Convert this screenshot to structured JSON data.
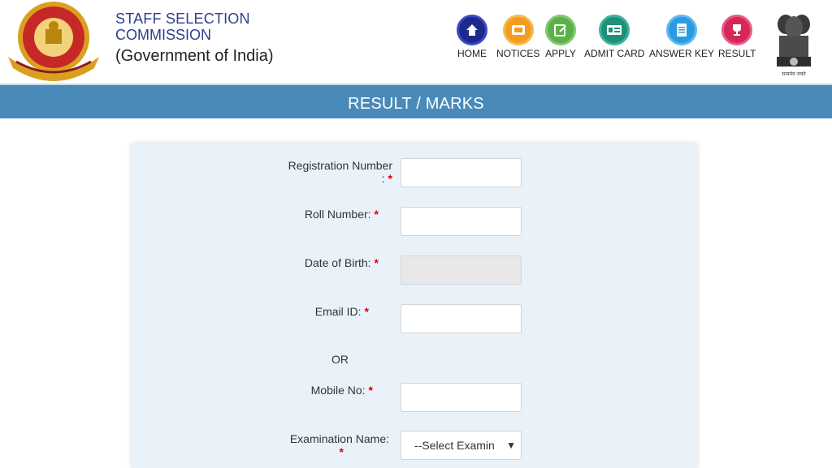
{
  "header": {
    "title_line1": "STAFF SELECTION",
    "title_line2": "COMMISSION",
    "title_line3": "(Government of India)",
    "emblem_caption": "सत्यमेव जयते"
  },
  "nav": [
    {
      "label": "HOME",
      "icon": "home-icon",
      "color": "#1d2a8c"
    },
    {
      "label": "NOTICES",
      "icon": "notices-icon",
      "color": "#f39c1f"
    },
    {
      "label": "APPLY",
      "icon": "apply-icon",
      "color": "#5bb04a"
    },
    {
      "label": "ADMIT CARD",
      "icon": "admit-card-icon",
      "color": "#1f8f7a"
    },
    {
      "label": "ANSWER KEY",
      "icon": "answer-key-icon",
      "color": "#2a9be0"
    },
    {
      "label": "RESULT",
      "icon": "result-icon",
      "color": "#d62858"
    }
  ],
  "banner": {
    "title": "RESULT / MARKS"
  },
  "form": {
    "registration_label": "Registration Number",
    "registration_suffix": ":",
    "roll_label": "Roll Number:",
    "dob_label": "Date of Birth:",
    "email_label": "Email ID:",
    "or_text": "OR",
    "mobile_label": "Mobile No:",
    "exam_label": "Examination Name:",
    "exam_select_value": "--Select Examin",
    "required_mark": "*"
  },
  "colors": {
    "banner": "#4a8ab8",
    "panel": "#eaf2f9",
    "required": "#d80000",
    "title": "#2d3f8f"
  }
}
